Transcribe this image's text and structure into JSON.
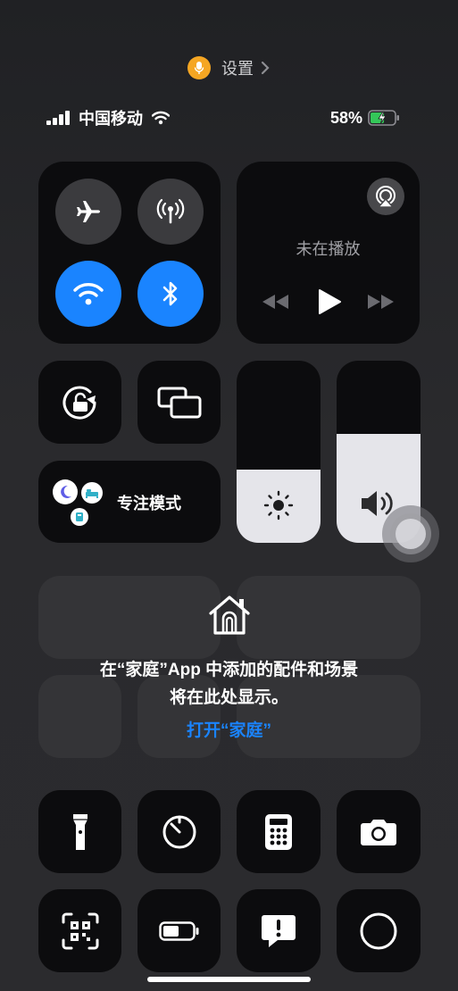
{
  "top_bar": {
    "settings_label": "设置"
  },
  "status_bar": {
    "carrier": "中国移动",
    "battery_percent": "58%",
    "battery_level": 0.58
  },
  "connectivity": {
    "airplane_on": false,
    "cellular_on": false,
    "wifi_on": true,
    "bluetooth_on": true
  },
  "now_playing": {
    "status": "未在播放"
  },
  "focus": {
    "label": "专注模式"
  },
  "brightness": {
    "level": 0.4
  },
  "volume": {
    "level": 0.6
  },
  "home": {
    "message_line1": "在“家庭”App 中添加的配件和场景",
    "message_line2": "将在此处显示。",
    "open_link": "打开“家庭”"
  },
  "colors": {
    "accent": "#1a84ff",
    "tile": "#0c0c0e",
    "charging": "#34c759",
    "mic": "#f5a623"
  }
}
